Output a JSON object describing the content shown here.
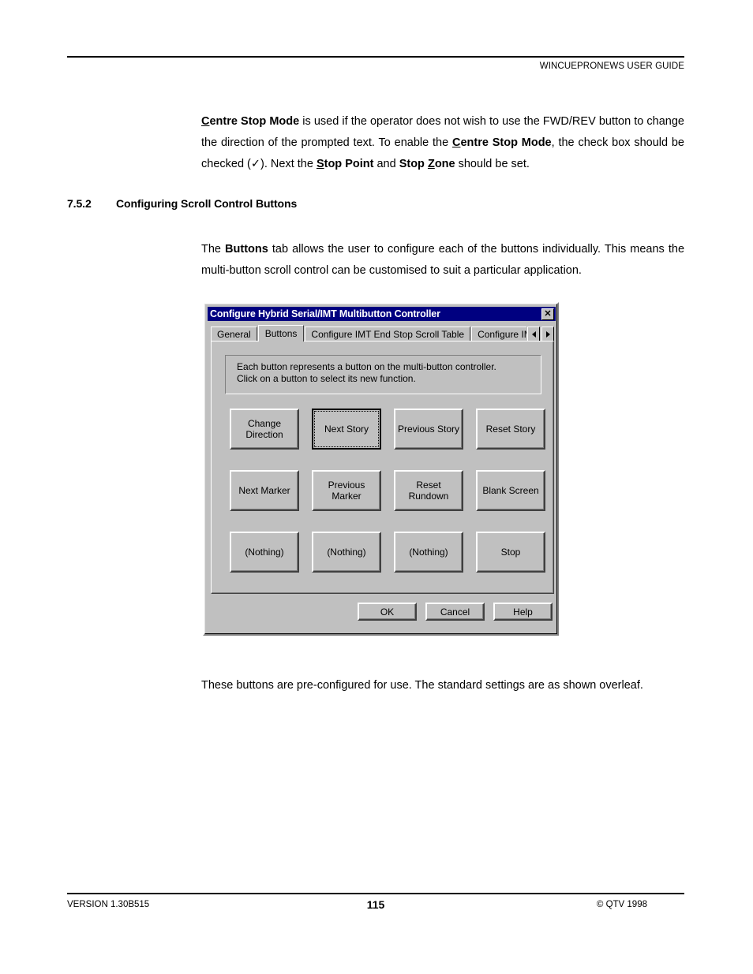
{
  "header": {
    "running_head": "WINCUEPRONEWS USER GUIDE"
  },
  "body": {
    "para_intro": {
      "full_text": "Centre Stop Mode is used if the operator does not wish to use the FWD/REV button to change the direction of the prompted text. To enable the Centre Stop Mode, the check box should be checked (✓). Next the Stop Point and Stop Zone should be set.",
      "seg1_bold_accel": "C",
      "seg1_bold_rest": "entre Stop Mode",
      "seg2": " is used if the operator does not wish to use the FWD/REV button to change the direction of the prompted text. To enable the ",
      "seg3_bold_accel": "C",
      "seg3_bold_rest": "entre Stop Mode",
      "seg4": ", the check box should be checked (",
      "checkmark": "✓",
      "seg5": "). Next the ",
      "seg6_bold_accel": "S",
      "seg6_bold_rest": "top Point",
      "seg7": " and ",
      "seg8_bold_pre": "Stop ",
      "seg8_bold_accel": "Z",
      "seg8_bold_rest": "one",
      "seg9": " should be set."
    },
    "section": {
      "number": "7.5.2",
      "title": "Configuring Scroll Control Buttons"
    },
    "para_buttons_tab": {
      "seg1": "The ",
      "seg2_bold": "Buttons",
      "seg3": " tab allows the user to configure each of the buttons individually. This means the multi-button scroll control can be customised to suit a particular application."
    },
    "para_preconfig": "These buttons are pre-configured for use. The standard settings are as shown overleaf."
  },
  "dialog": {
    "title": "Configure Hybrid Serial/IMT Multibutton Controller",
    "close_glyph": "✕",
    "tabs": [
      {
        "label": "General",
        "active": false
      },
      {
        "label": "Buttons",
        "active": true
      },
      {
        "label": "Configure IMT End Stop Scroll Table",
        "active": false
      },
      {
        "label": "Configure IMT Cen",
        "active": false
      }
    ],
    "tab_scroll_left": "◄",
    "tab_scroll_right": "►",
    "info_lines": [
      "Each button represents a button on the multi-button controller.",
      "Click on a button to select its new function."
    ],
    "function_buttons": [
      {
        "label": "Change\nDirection",
        "focused": false
      },
      {
        "label": "Next Story",
        "focused": true
      },
      {
        "label": "Previous Story",
        "focused": false
      },
      {
        "label": "Reset Story",
        "focused": false
      },
      {
        "label": "Next Marker",
        "focused": false
      },
      {
        "label": "Previous\nMarker",
        "focused": false
      },
      {
        "label": "Reset\nRundown",
        "focused": false
      },
      {
        "label": "Blank Screen",
        "focused": false
      },
      {
        "label": "(Nothing)",
        "focused": false
      },
      {
        "label": "(Nothing)",
        "focused": false
      },
      {
        "label": "(Nothing)",
        "focused": false
      },
      {
        "label": "Stop",
        "focused": false
      }
    ],
    "action_buttons": [
      {
        "label": "OK"
      },
      {
        "label": "Cancel"
      },
      {
        "label": "Help"
      }
    ],
    "colors": {
      "titlebar": "#000080",
      "titlebar_text": "#ffffff",
      "face": "#c0c0c0",
      "shadow": "#808080",
      "dark_shadow": "#404040",
      "highlight": "#ffffff"
    }
  },
  "footer": {
    "version": "VERSION 1.30B515",
    "page_number": "115",
    "copyright": "© QTV 1998"
  }
}
